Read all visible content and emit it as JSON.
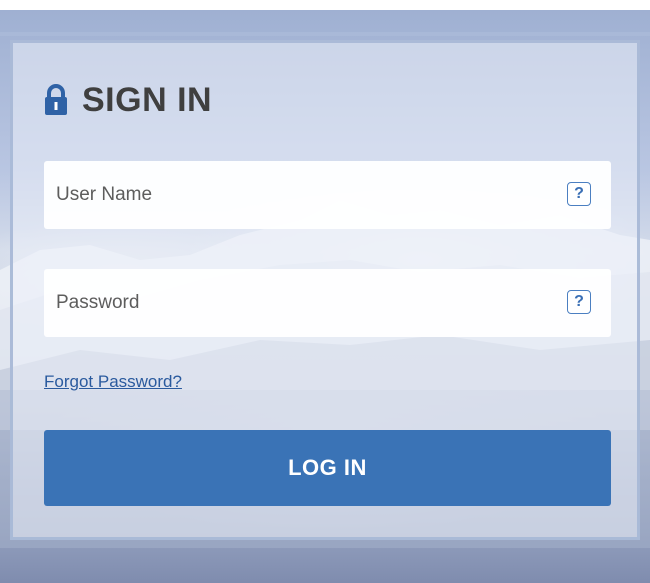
{
  "header": {
    "title": "SIGN IN",
    "icon": "lock-icon"
  },
  "form": {
    "username": {
      "placeholder": "User Name",
      "value": "",
      "help_label": "?"
    },
    "password": {
      "placeholder": "Password",
      "value": "",
      "help_label": "?"
    },
    "forgot_password_label": "Forgot Password?",
    "login_label": "LOG IN"
  },
  "colors": {
    "accent": "#3a73b6",
    "title_text": "#3f3f3f",
    "link": "#2a5a9e",
    "help_border": "#4b7fc1"
  }
}
